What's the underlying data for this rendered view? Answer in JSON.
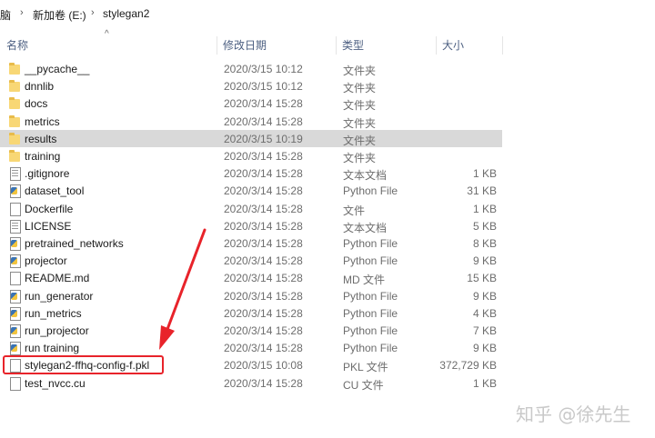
{
  "breadcrumb": {
    "items": [
      "脑",
      "新加卷 (E:)",
      "stylegan2"
    ],
    "separator": "›"
  },
  "columns": {
    "name": "名称",
    "date": "修改日期",
    "type": "类型",
    "size": "大小"
  },
  "files": [
    {
      "name": "__pycache__",
      "date": "2020/3/15 10:12",
      "type": "文件夹",
      "size": "",
      "icon": "folder-icon"
    },
    {
      "name": "dnnlib",
      "date": "2020/3/15 10:12",
      "type": "文件夹",
      "size": "",
      "icon": "folder-icon"
    },
    {
      "name": "docs",
      "date": "2020/3/14 15:28",
      "type": "文件夹",
      "size": "",
      "icon": "folder-icon"
    },
    {
      "name": "metrics",
      "date": "2020/3/14 15:28",
      "type": "文件夹",
      "size": "",
      "icon": "folder-icon"
    },
    {
      "name": "results",
      "date": "2020/3/15 10:19",
      "type": "文件夹",
      "size": "",
      "icon": "folder-icon",
      "selected": true
    },
    {
      "name": "training",
      "date": "2020/3/14 15:28",
      "type": "文件夹",
      "size": "",
      "icon": "folder-icon"
    },
    {
      "name": ".gitignore",
      "date": "2020/3/14 15:28",
      "type": "文本文档",
      "size": "1 KB",
      "icon": "text-file-icon"
    },
    {
      "name": "dataset_tool",
      "date": "2020/3/14 15:28",
      "type": "Python File",
      "size": "31 KB",
      "icon": "python-file-icon"
    },
    {
      "name": "Dockerfile",
      "date": "2020/3/14 15:28",
      "type": "文件",
      "size": "1 KB",
      "icon": "file-icon"
    },
    {
      "name": "LICENSE",
      "date": "2020/3/14 15:28",
      "type": "文本文档",
      "size": "5 KB",
      "icon": "text-file-icon"
    },
    {
      "name": "pretrained_networks",
      "date": "2020/3/14 15:28",
      "type": "Python File",
      "size": "8 KB",
      "icon": "python-file-icon"
    },
    {
      "name": "projector",
      "date": "2020/3/14 15:28",
      "type": "Python File",
      "size": "9 KB",
      "icon": "python-file-icon"
    },
    {
      "name": "README.md",
      "date": "2020/3/14 15:28",
      "type": "MD 文件",
      "size": "15 KB",
      "icon": "file-icon"
    },
    {
      "name": "run_generator",
      "date": "2020/3/14 15:28",
      "type": "Python File",
      "size": "9 KB",
      "icon": "python-file-icon"
    },
    {
      "name": "run_metrics",
      "date": "2020/3/14 15:28",
      "type": "Python File",
      "size": "4 KB",
      "icon": "python-file-icon"
    },
    {
      "name": "run_projector",
      "date": "2020/3/14 15:28",
      "type": "Python File",
      "size": "7 KB",
      "icon": "python-file-icon"
    },
    {
      "name": "run training",
      "date": "2020/3/14 15:28",
      "type": "Python File",
      "size": "9 KB",
      "icon": "python-file-icon"
    },
    {
      "name": "stylegan2-ffhq-config-f.pkl",
      "date": "2020/3/15 10:08",
      "type": "PKL 文件",
      "size": "372,729 KB",
      "icon": "file-icon"
    },
    {
      "name": "test_nvcc.cu",
      "date": "2020/3/14 15:28",
      "type": "CU 文件",
      "size": "1 KB",
      "icon": "file-icon"
    }
  ],
  "watermark": "知乎 @徐先生",
  "colors": {
    "selection": "#d9d9d9",
    "annotation": "#e8232a",
    "folder": "#f8d775"
  }
}
